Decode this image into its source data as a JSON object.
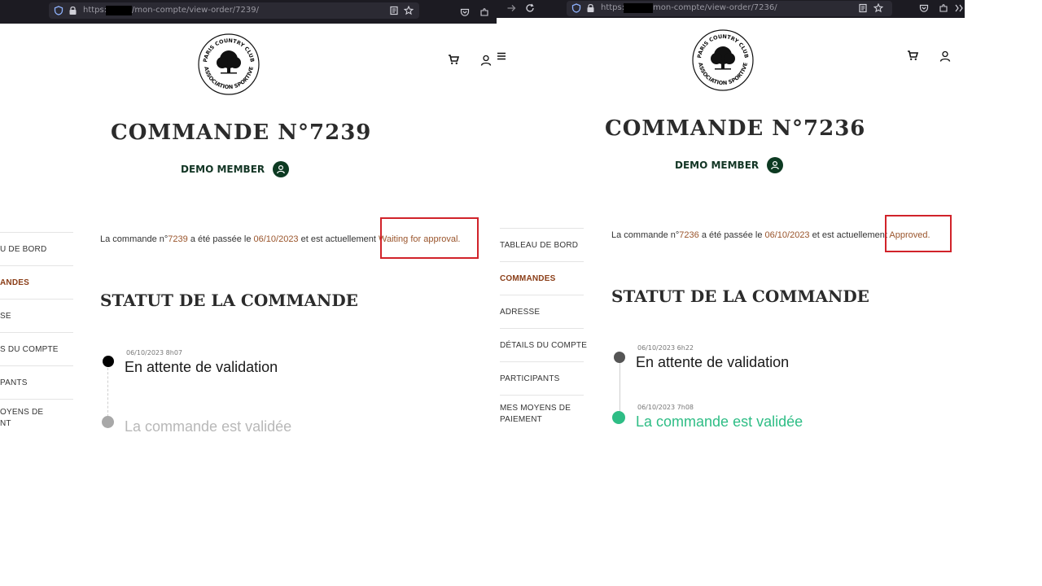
{
  "left": {
    "url_prefix": "https://",
    "url_path": "/mon-compte/view-order/7239/",
    "title": "COMMANDE N°7239",
    "member_name": "DEMO MEMBER",
    "nav": [
      "U DE BORD",
      "ANDES",
      "SE",
      "S DU COMPTE",
      "PANTS",
      "OYENS DE\nNT"
    ],
    "summary": {
      "t1": "La commande n°",
      "num": "7239",
      "t2": " a été passée le ",
      "date": "06/10/2023",
      "t3": " et est actuellement ",
      "status": "Waiting for approval."
    },
    "section_title": "STATUT DE LA COMMANDE",
    "timeline": [
      {
        "date": "06/10/2023 8h07",
        "label": "En attente de validation"
      },
      {
        "label": "La commande est validée"
      }
    ]
  },
  "right": {
    "url_prefix": "https://",
    "url_path": "mon-compte/view-order/7236/",
    "title": "COMMANDE N°7236",
    "member_name": "DEMO MEMBER",
    "nav": [
      "TABLEAU DE BORD",
      "COMMANDES",
      "ADRESSE",
      "DÉTAILS DU COMPTE",
      "PARTICIPANTS",
      "MES MOYENS DE PAIEMENT"
    ],
    "summary": {
      "t1": "La commande n°",
      "num": "7236",
      "t2": " a été passée le ",
      "date": "06/10/2023",
      "t3": " et est actuellement ",
      "status": "Approved."
    },
    "section_title": "STATUT DE LA COMMANDE",
    "timeline": [
      {
        "date": "06/10/2023 6h22",
        "label": "En attente de validation"
      },
      {
        "date": "06/10/2023 7h08",
        "label": "La commande est validée"
      }
    ]
  },
  "logo_text": {
    "top": "PARIS COUNTRY CLUB",
    "bottom": "ASSOCIATION SPORTIVE"
  },
  "colors": {
    "accent_brown": "#9a552c",
    "nav_active": "#8a3d17",
    "highlight_red": "#d1232a",
    "validated_green": "#2ebd85",
    "dark_green": "#0d3a22",
    "browser_bar": "#1c1b22"
  },
  "icons": [
    "shield-icon",
    "lock-icon",
    "reader-icon",
    "star-icon",
    "pocket-icon",
    "extensions-icon",
    "back-icon",
    "reload-icon",
    "cart-icon",
    "user-icon",
    "menu-icon",
    "tree-icon"
  ]
}
